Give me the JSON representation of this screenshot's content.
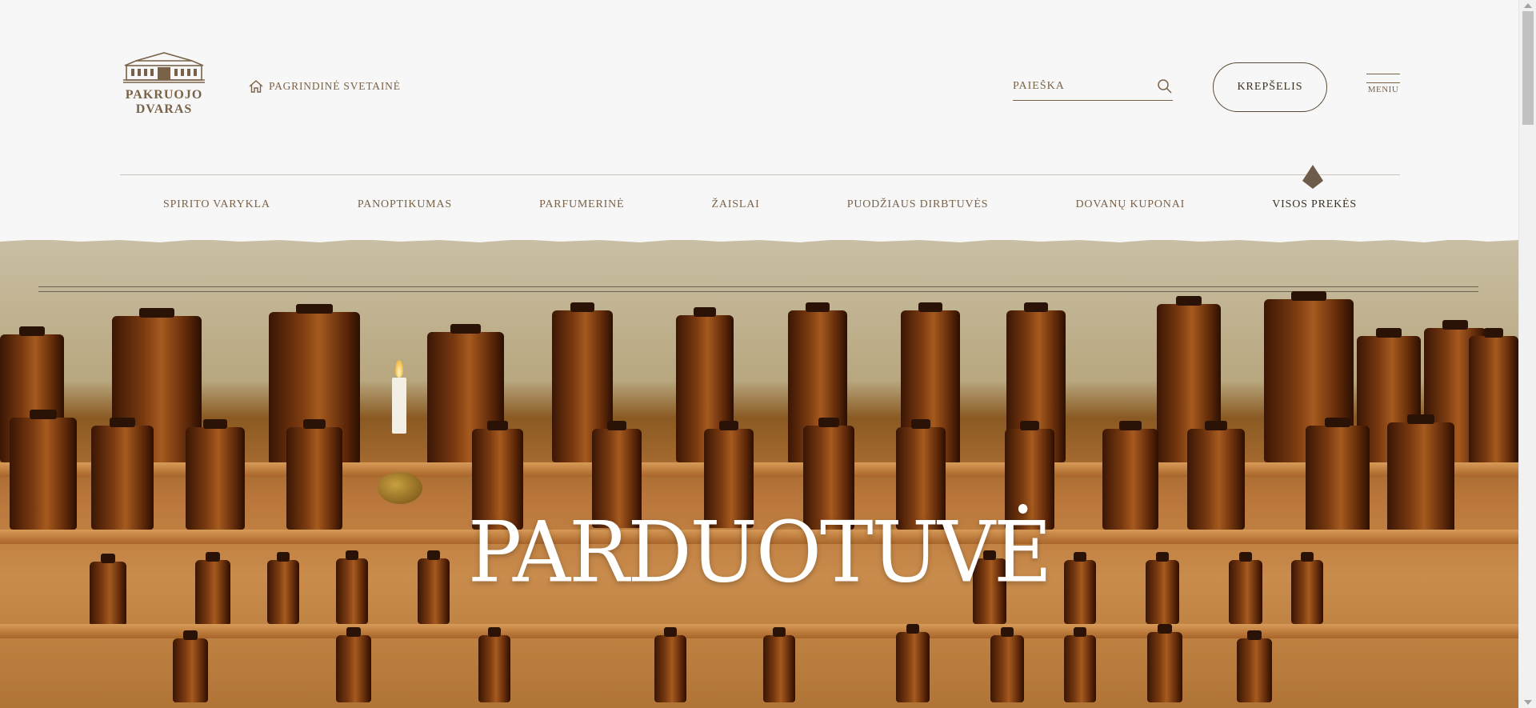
{
  "brand": {
    "name_line1": "PAKRUOJO",
    "name_line2": "DVARAS",
    "icon": "manor-logo-icon"
  },
  "header": {
    "home_link": "PAGRINDINĖ SVETAINĖ",
    "search_placeholder": "PAIEŠKA",
    "cart_label": "KREPŠELIS",
    "menu_label": "MENIU"
  },
  "nav": {
    "items": [
      {
        "label": "SPIRITO VARYKLA"
      },
      {
        "label": "PANOPTIKUMAS"
      },
      {
        "label": "PARFUMERINĖ"
      },
      {
        "label": "ŽAISLAI"
      },
      {
        "label": "PUODŽIAUS DIRBTUVĖS"
      },
      {
        "label": "DOVANŲ KUPONAI"
      },
      {
        "label": "VISOS PREKĖS"
      }
    ],
    "active_index": 6
  },
  "hero": {
    "title": "PARDUOTUVĖ"
  },
  "colors": {
    "accent": "#7a6248",
    "dark": "#3e3022",
    "background": "#f7f7f7"
  }
}
